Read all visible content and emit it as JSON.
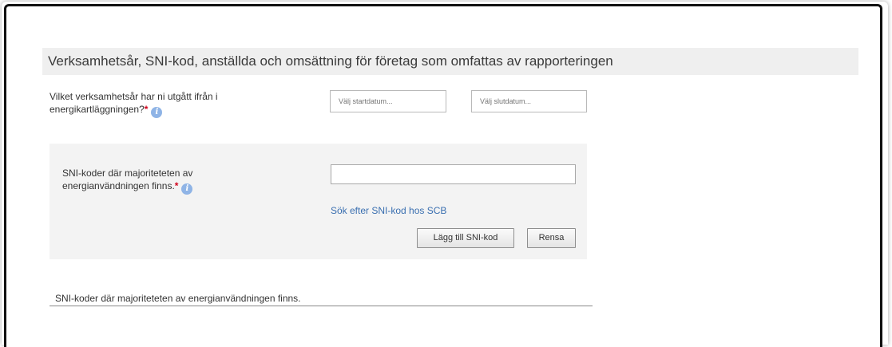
{
  "section": {
    "title": "Verksamhetsår, SNI-kod, anställda och omsättning för företag som omfattas av rapporteringen"
  },
  "year_field": {
    "label_line1": "Vilket verksamhetsår har ni utgått ifrån i",
    "label_line2": "energikartläggningen?",
    "required_mark": "*",
    "start_placeholder": "Välj startdatum...",
    "end_placeholder": "Välj slutdatum..."
  },
  "sni_field": {
    "label_line1": "SNI-koder där majoriteteten av",
    "label_line2": "energianvändningen finns.",
    "required_mark": "*",
    "value": "",
    "search_link": "Sök efter SNI-kod hos SCB",
    "add_button": "Lägg till SNI-kod",
    "clear_button": "Rensa"
  },
  "sni_list": {
    "heading": "SNI-koder där majoriteteten av energianvändningen finns."
  },
  "icons": {
    "info": "info-icon"
  },
  "colors": {
    "required": "#d0021b",
    "info_icon": "#8fb4e6",
    "link": "#3a6fb0",
    "header_bg": "#efefef",
    "panel_bg": "#f3f3f3"
  }
}
